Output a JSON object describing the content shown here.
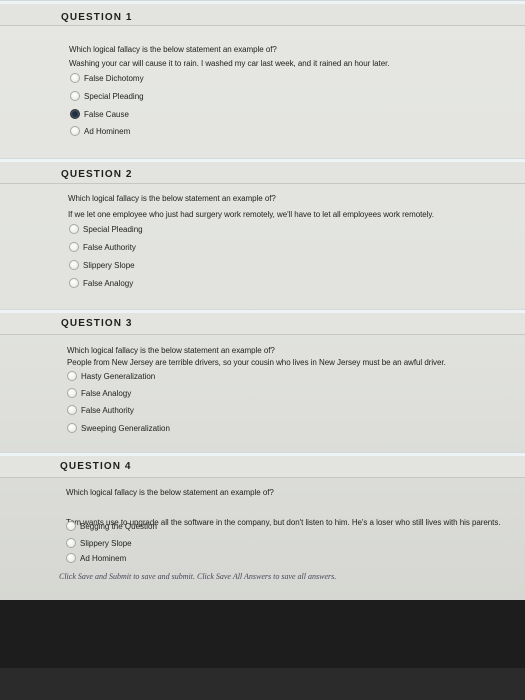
{
  "questions": [
    {
      "title": "QUESTION 1",
      "prompt": "Which logical fallacy is the below statement an example of?",
      "statement": "Washing your car will cause it to rain. I washed my car last week, and it rained an hour later.",
      "options": [
        {
          "label": "False Dichotomy",
          "selected": false
        },
        {
          "label": "Special Pleading",
          "selected": false
        },
        {
          "label": "False Cause",
          "selected": true
        },
        {
          "label": "Ad Hominem",
          "selected": false
        }
      ]
    },
    {
      "title": "QUESTION 2",
      "prompt": "Which logical fallacy is the below statement an example of?",
      "statement": "If we let one employee who just had surgery work remotely, we'll have to let all employees work remotely.",
      "options": [
        {
          "label": "Special Pleading",
          "selected": false
        },
        {
          "label": "False Authority",
          "selected": false
        },
        {
          "label": "Slippery Slope",
          "selected": false
        },
        {
          "label": "False Analogy",
          "selected": false
        }
      ]
    },
    {
      "title": "QUESTION 3",
      "prompt": "Which logical fallacy is the below statement an example of?",
      "statement": "People from New Jersey are terrible drivers, so your cousin who lives in New Jersey must be an awful driver.",
      "options": [
        {
          "label": "Hasty Generalization",
          "selected": false
        },
        {
          "label": "False Analogy",
          "selected": false
        },
        {
          "label": "False Authority",
          "selected": false
        },
        {
          "label": "Sweeping Generalization",
          "selected": false
        }
      ]
    },
    {
      "title": "QUESTION 4",
      "prompt": "Which logical fallacy is the below statement an example of?",
      "statement": "Tom wants use to upgrade all the software in the company, but don't listen to him. He's a loser who still lives with his parents.",
      "options": [
        {
          "label": "Begging the Question",
          "selected": false
        },
        {
          "label": "Slippery Slope",
          "selected": false
        },
        {
          "label": "Ad Hominem",
          "selected": false
        }
      ]
    }
  ],
  "footer_note": "Click Save and Submit to save and submit. Click Save All Answers to save all answers."
}
